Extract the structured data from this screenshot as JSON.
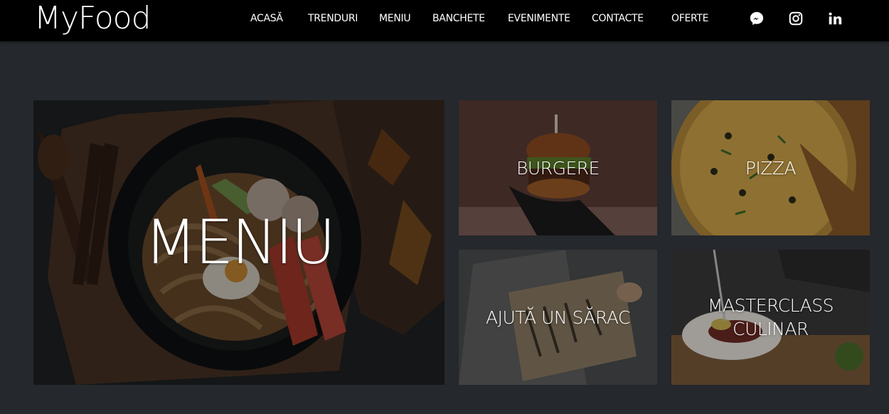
{
  "site": {
    "logo": "MyFood"
  },
  "nav": {
    "items": [
      {
        "label": "ACASĂ"
      },
      {
        "label": "TRENDURI"
      },
      {
        "label": "MENIU"
      },
      {
        "label": "BANCHETE"
      },
      {
        "label": "EVENIMENTE"
      },
      {
        "label": "CONTACTE"
      },
      {
        "label": "OFERTE"
      }
    ],
    "social": [
      {
        "icon": "messenger-icon"
      },
      {
        "icon": "instagram-icon"
      },
      {
        "icon": "linkedin-icon"
      }
    ]
  },
  "tiles": {
    "menu": {
      "label": "MENIU"
    },
    "burgers": {
      "label": "BURGERE"
    },
    "pizza": {
      "label": "PIZZA"
    },
    "help": {
      "label": "AJUTĂ UN SĂRAC"
    },
    "masterclass": {
      "label": "MASTERCLASS CULINAR"
    }
  },
  "colors": {
    "page_bg": "#25282c",
    "header_bg": "#000000",
    "text": "#ffffff"
  }
}
